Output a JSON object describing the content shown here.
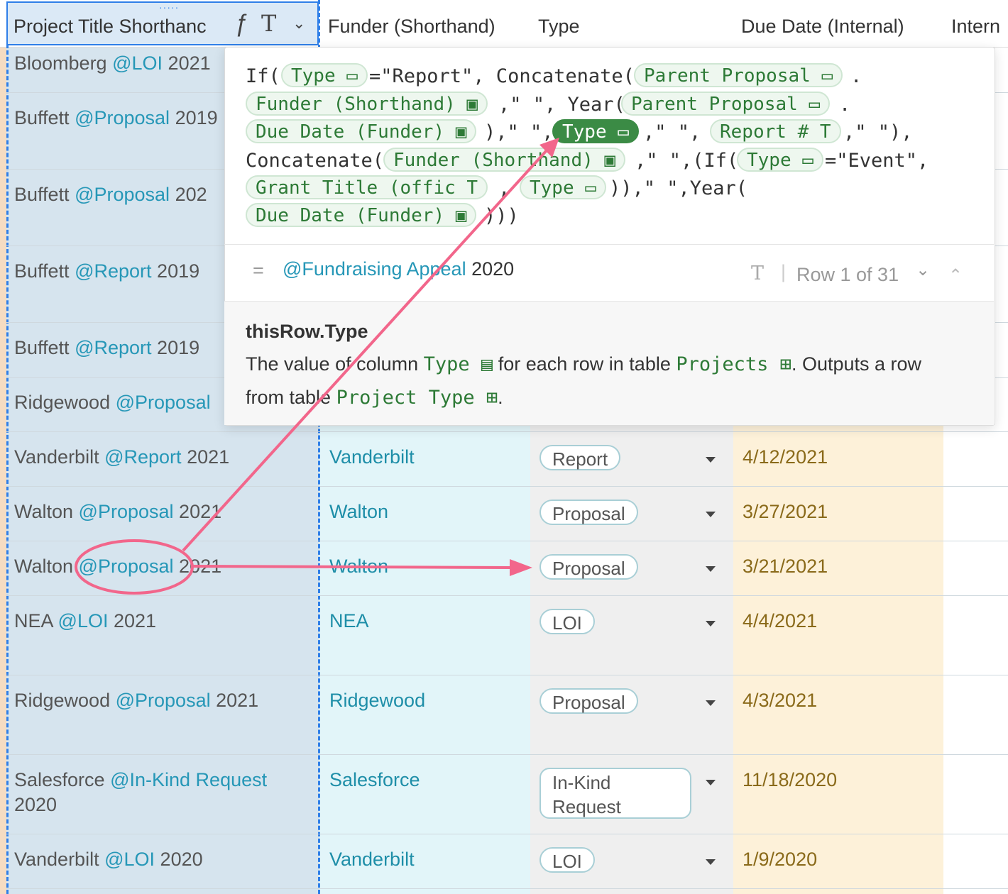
{
  "header": {
    "title_col": "Project Title Shorthanc",
    "title_col_icon": "ƒ",
    "title_col_type_icon": "T",
    "funder_col": "Funder (Shorthand)",
    "type_col": "Type",
    "due_col": "Due Date (Internal)",
    "extra_col": "Intern"
  },
  "rows": [
    {
      "funder_prefix": "Bloomberg",
      "mention": "@LOI",
      "year": "2021"
    },
    {
      "funder_prefix": "Buffett",
      "mention": "@Proposal",
      "year": "2019"
    },
    {
      "funder_prefix": "Buffett",
      "mention": "@Proposal",
      "year": "202"
    },
    {
      "funder_prefix": "Buffett",
      "mention": "@Report",
      "year": "2019"
    },
    {
      "funder_prefix": "Buffett",
      "mention": "@Report",
      "year": "2019"
    },
    {
      "funder_prefix": "Ridgewood",
      "mention": "@Proposal",
      "year": ""
    },
    {
      "funder_prefix": "Vanderbilt",
      "mention": "@Report",
      "year": "2021",
      "funder": "Vanderbilt",
      "type": "Report",
      "due": "4/12/2021"
    },
    {
      "funder_prefix": "Walton",
      "mention": "@Proposal",
      "year": "2021",
      "funder": "Walton",
      "type": "Proposal",
      "due": "3/27/2021"
    },
    {
      "funder_prefix": "Walton",
      "mention": "@Proposal",
      "year": "2021",
      "funder": "Walton",
      "type": "Proposal",
      "due": "3/21/2021"
    },
    {
      "funder_prefix": "NEA",
      "mention": "@LOI",
      "year": "2021",
      "funder": "NEA",
      "type": "LOI",
      "due": "4/4/2021"
    },
    {
      "funder_prefix": "Ridgewood",
      "mention": "@Proposal",
      "year": "2021",
      "funder": "Ridgewood",
      "type": "Proposal",
      "due": "4/3/2021"
    },
    {
      "funder_prefix": "Salesforce",
      "mention": "@In-Kind Request",
      "year": "2020",
      "funder": "Salesforce",
      "type_line1": "In-Kind",
      "type_line2": "Request",
      "due": "11/18/2020"
    },
    {
      "funder_prefix": "Vanderbilt",
      "mention": "@LOI",
      "year": "2020",
      "funder": "Vanderbilt",
      "type": "LOI",
      "due": "1/9/2020"
    }
  ],
  "formula": {
    "l1_a": "If(",
    "l1_chip1": "Type ▭",
    "l1_b": "=\"Report\", Concatenate(",
    "l1_chip2": "Parent Proposal ▭",
    "l1_c": ".",
    "l2_chip1": "Funder (Shorthand) ▣",
    "l2_b": ",\" \", Year(",
    "l2_chip2": "Parent Proposal ▭",
    "l2_c": ".",
    "l3_chip1": "Due Date (Funder) ▣",
    "l3_b": "),\" \",",
    "l3_chip2": "Type ▭",
    "l3_c": ",\" \",",
    "l3_chip3": "Report # T",
    "l3_d": ",\" \"),",
    "l4_a": "Concatenate(",
    "l4_chip1": "Funder (Shorthand) ▣",
    "l4_b": ",\" \",(If(",
    "l4_chip2": "Type ▭",
    "l4_c": "=\"Event\",",
    "l5_chip1": "Grant Title (offic T",
    "l5_b": ",",
    "l5_chip2": "Type ▭",
    "l5_c": ")),\" \",Year(",
    "l6_chip1": "Due Date (Funder) ▣",
    "l6_b": ")))"
  },
  "result": {
    "equals": "=",
    "mention": "@Fundraising Appeal",
    "year": "2020",
    "type_icon": "T",
    "row_counter": "Row 1 of 31"
  },
  "doc": {
    "title": "thisRow.Type",
    "line1_a": "The value of column",
    "line1_code1": "Type ▤",
    "line1_b": "for each row in table",
    "line1_code2": "Projects ⊞",
    "line1_c": ". Outputs a row",
    "line2_a": "from table",
    "line2_code": "Project Type ⊞",
    "line2_b": "."
  },
  "colors": {
    "accent_pink": "#f2668b",
    "selection_blue": "#2f7fe8",
    "chip_green": "#2d7a36"
  }
}
